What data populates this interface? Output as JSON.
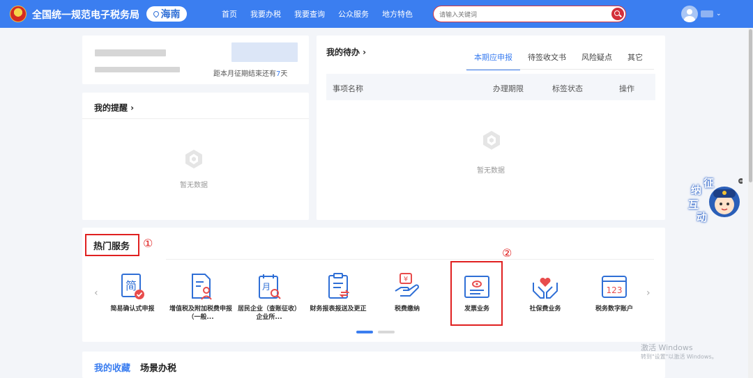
{
  "header": {
    "site_title": "全国统一规范电子税务局",
    "region": "海南",
    "nav": [
      "首页",
      "我要办税",
      "我要查询",
      "公众服务",
      "地方特色"
    ],
    "search_placeholder": "请输入关键词",
    "user_chevron": "⌄"
  },
  "account": {
    "deadline_prefix": "距本月征期结束还有",
    "deadline_days": "7",
    "deadline_suffix": "天"
  },
  "reminders": {
    "title": "我的提醒 ›",
    "empty": "暂无数据"
  },
  "todo": {
    "title": "我的待办 ›",
    "tabs": [
      "本期应申报",
      "待签收文书",
      "风险疑点",
      "其它"
    ],
    "columns": [
      "事项名称",
      "办理期限",
      "标签状态",
      "操作"
    ],
    "empty": "暂无数据"
  },
  "hot_services": {
    "title": "热门服务",
    "marker_1": "①",
    "marker_2": "②",
    "items": [
      {
        "label": "简易确认式申报",
        "icon": "simple-declare-icon"
      },
      {
        "label": "增值税及附加税费申报（一般...",
        "icon": "vat-declare-icon"
      },
      {
        "label": "居民企业（查账征收）企业所...",
        "icon": "enterprise-income-icon"
      },
      {
        "label": "财务报表报送及更正",
        "icon": "financial-report-icon"
      },
      {
        "label": "税费缴纳",
        "icon": "tax-payment-icon"
      },
      {
        "label": "发票业务",
        "icon": "invoice-icon"
      },
      {
        "label": "社保费业务",
        "icon": "social-security-icon"
      },
      {
        "label": "税务数字账户",
        "icon": "digital-account-icon"
      }
    ]
  },
  "favorites": {
    "tabs": [
      "我的收藏",
      "场景办税"
    ]
  },
  "mascot": {
    "text_chars": [
      "征",
      "纳",
      "互",
      "动"
    ]
  },
  "watermark": {
    "line1": "激活 Windows",
    "line2": "转到\"设置\"以激活 Windows。"
  },
  "colors": {
    "primary": "#3b7ef0",
    "highlight_red": "#e02020"
  }
}
